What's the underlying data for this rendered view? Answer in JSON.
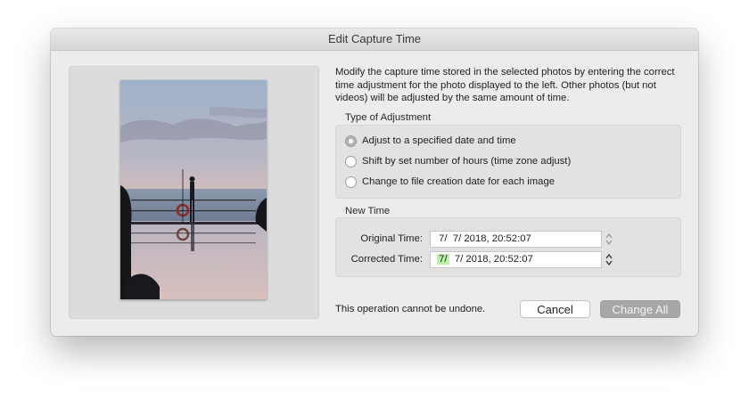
{
  "window": {
    "title": "Edit Capture Time"
  },
  "description": "Modify the capture time stored in the selected photos by entering the correct time adjustment for the photo displayed to the left. Other photos (but not videos) will be adjusted by the same amount of time.",
  "adjustment": {
    "label": "Type of Adjustment",
    "options": [
      {
        "label": "Adjust to a specified date and time",
        "selected": true
      },
      {
        "label": "Shift by set number of hours (time zone adjust)",
        "selected": false
      },
      {
        "label": "Change to file creation date for each image",
        "selected": false
      }
    ]
  },
  "new_time": {
    "label": "New Time",
    "original_label": "Original Time:",
    "original_value": " 7/  7/ 2018, 20:52:07",
    "corrected_label": "Corrected Time:",
    "corrected_month": "7/",
    "corrected_rest": "  7/ 2018, 20:52:07"
  },
  "footer": {
    "warning": "This operation cannot be undone.",
    "cancel_label": "Cancel",
    "confirm_label": "Change All"
  }
}
